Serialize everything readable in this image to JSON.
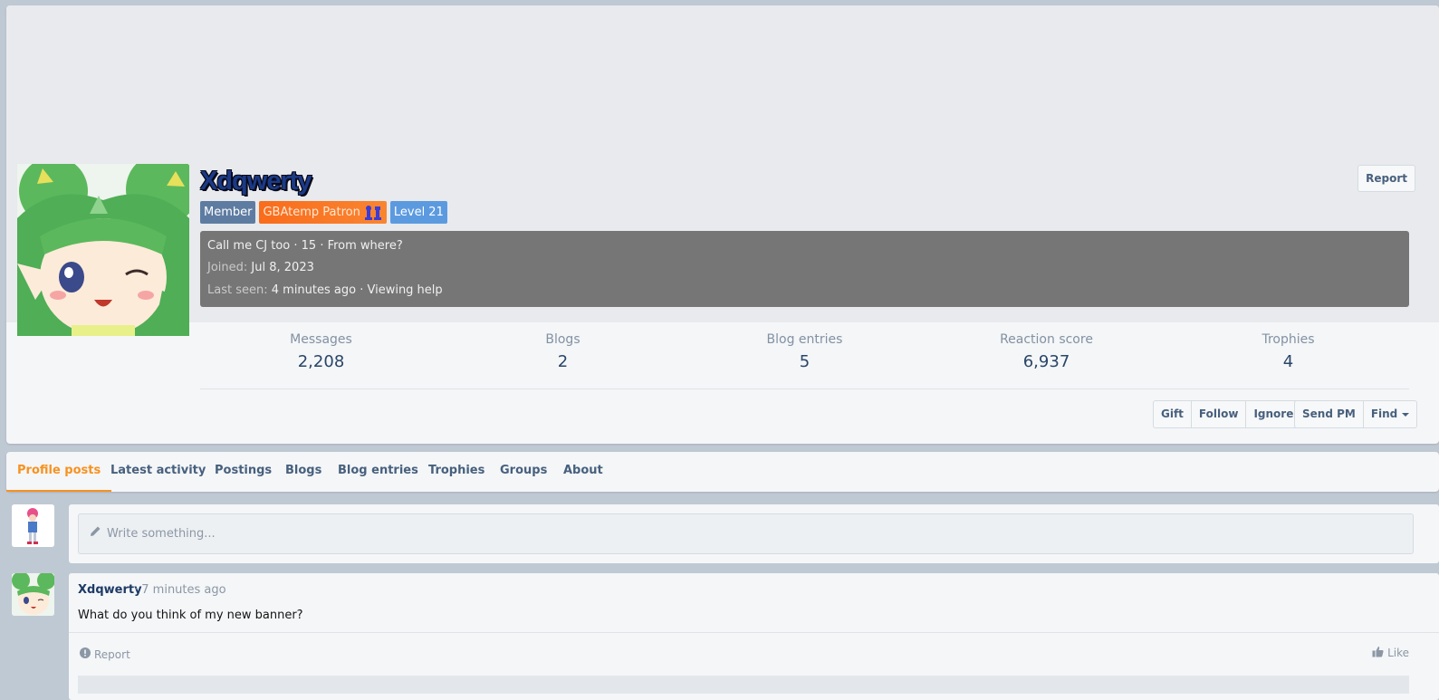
{
  "profile": {
    "username": "Xdqwerty",
    "report_label": "Report",
    "badges": {
      "member": "Member",
      "patron": "GBAtemp Patron",
      "level": "Level 21"
    },
    "info": {
      "tagline": "Call me CJ too · 15 · From where?",
      "joined_label": "Joined:",
      "joined_value": "Jul 8, 2023",
      "last_seen_label": "Last seen:",
      "last_seen_value": "4 minutes ago · Viewing help"
    },
    "stats": [
      {
        "label": "Messages",
        "value": "2,208"
      },
      {
        "label": "Blogs",
        "value": "2"
      },
      {
        "label": "Blog entries",
        "value": "5"
      },
      {
        "label": "Reaction score",
        "value": "6,937"
      },
      {
        "label": "Trophies",
        "value": "4"
      }
    ],
    "actions": {
      "gift": "Gift",
      "follow": "Follow",
      "ignore": "Ignore",
      "send_pm": "Send PM",
      "find": "Find"
    }
  },
  "tabs": [
    "Profile posts",
    "Latest activity",
    "Postings",
    "Blogs",
    "Blog entries",
    "Trophies",
    "Groups",
    "About"
  ],
  "active_tab": "Profile posts",
  "composer": {
    "placeholder": "Write something..."
  },
  "post": {
    "author": "Xdqwerty",
    "time": "· 7 minutes ago",
    "body": "What do you think of my new banner?",
    "report_label": "Report",
    "like_label": "Like"
  },
  "colors": {
    "accent": "#f7921e",
    "link": "#47607d",
    "patron_badge": "#f96c1c",
    "member_badge": "#5e7ca1",
    "level_badge": "#5c9ae0",
    "info_box": "#767676"
  },
  "icons": {
    "pencil": "pencil-icon",
    "report": "exclamation-circle-icon",
    "like": "thumbs-up-icon",
    "patron": "chess-pieces-icon"
  }
}
